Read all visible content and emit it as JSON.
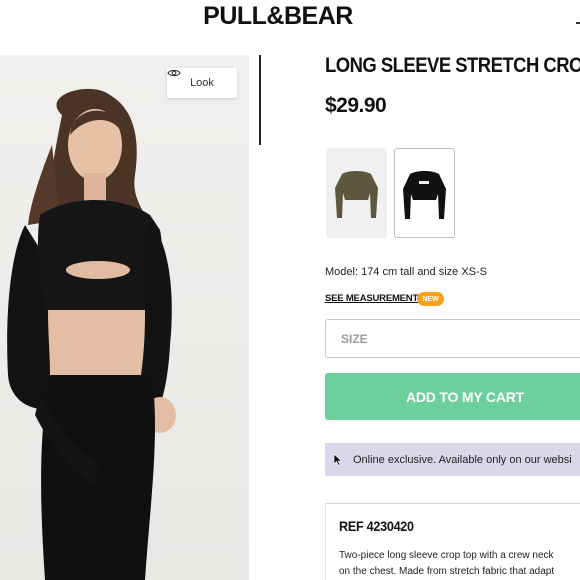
{
  "header": {
    "logo": "PULL&BEAR"
  },
  "gallery": {
    "look_label": "Look"
  },
  "product": {
    "title": "LONG SLEEVE STRETCH CROP",
    "price": "$29.90",
    "colors": [
      {
        "name": "khaki",
        "hex": "#5d573f"
      },
      {
        "name": "black",
        "hex": "#111111"
      }
    ],
    "selected_color_index": 1,
    "model_info": "Model: 174 cm tall and size XS-S",
    "measurements_link": "SEE MEASUREMENTS",
    "new_badge": "NEW",
    "size_placeholder": "SIZE",
    "add_to_cart": "ADD TO MY CART",
    "exclusive_text": "Online exclusive. Available only on our websi",
    "ref": "REF 4230420",
    "description_lines": [
      "Two-piece long sleeve crop top with a crew neck",
      "on the chest. Made from stretch fabric that adapt"
    ]
  },
  "colors": {
    "cart_button": "#6ccf9c",
    "badge": "#f5a11d",
    "exclusive_banner": "#d9d7ea"
  }
}
